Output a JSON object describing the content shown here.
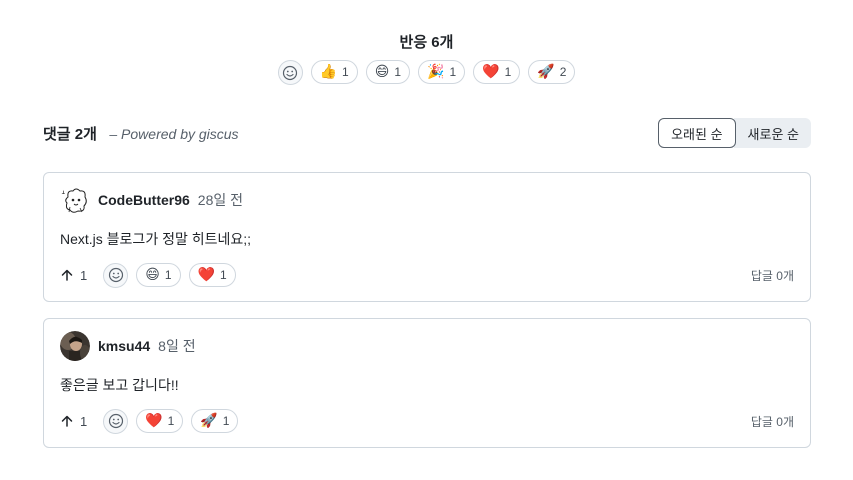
{
  "reactions": {
    "title": "반응 6개",
    "items": [
      {
        "emoji": "👍",
        "count": "1",
        "name": "thumbs-up"
      },
      {
        "emoji": "😄",
        "count": "1",
        "name": "laugh"
      },
      {
        "emoji": "🎉",
        "count": "1",
        "name": "hooray"
      },
      {
        "emoji": "❤️",
        "count": "1",
        "name": "heart"
      },
      {
        "emoji": "🚀",
        "count": "2",
        "name": "rocket"
      }
    ]
  },
  "comments_header": {
    "title": "댓글 2개",
    "powered_by": "– Powered by giscus",
    "sort_oldest": "오래된 순",
    "sort_newest": "새로운 순"
  },
  "comments": [
    {
      "author": "CodeButter96",
      "time": "28일 전",
      "body": "Next.js 블로그가 정말 히트네요;;",
      "upvotes": "1",
      "reactions": [
        {
          "emoji": "😄",
          "count": "1"
        },
        {
          "emoji": "❤️",
          "count": "1"
        }
      ],
      "replies": "답글 0개"
    },
    {
      "author": "kmsu44",
      "time": "8일 전",
      "body": "좋은글 보고 갑니다!!",
      "upvotes": "1",
      "reactions": [
        {
          "emoji": "❤️",
          "count": "1"
        },
        {
          "emoji": "🚀",
          "count": "1"
        }
      ],
      "replies": "답글 0개"
    }
  ],
  "colors": {
    "border": "#d0d7de",
    "muted_text": "#57606a",
    "text": "#1f2328",
    "sort_inactive_bg": "#eaeef2"
  }
}
